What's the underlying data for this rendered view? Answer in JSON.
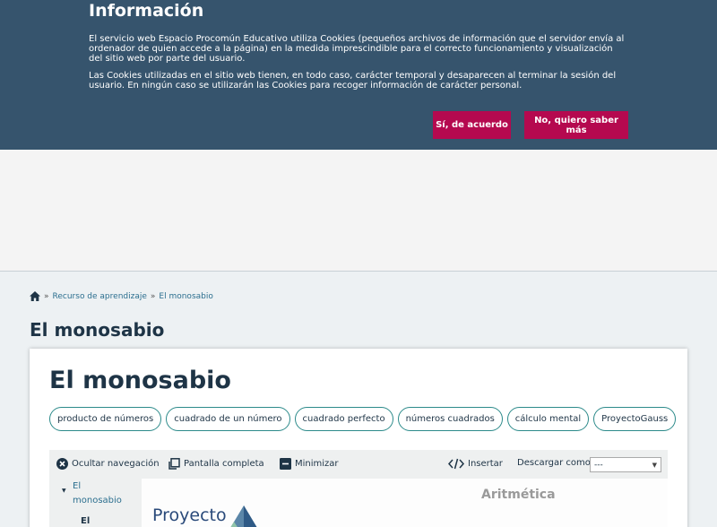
{
  "cookie": {
    "title": "Información",
    "text1": "El servicio web Espacio Procomún Educativo utiliza Cookies (pequeños archivos de información que el servidor envía al ordenador de quien accede a la página) en la medida imprescindible para el correcto funcionamiento y visualización del sitio web por parte del usuario.",
    "text2": "Las Cookies utilizadas en el sitio web tienen, en todo caso, carácter temporal y desaparecen al terminar la sesión del usuario. En ningún caso se utilizarán las Cookies para recoger información de carácter personal.",
    "accept_label": "Sí, de acuerdo",
    "more_label": "No, quiero saber más"
  },
  "breadcrumb": {
    "home_icon": "home-icon",
    "sep1": "»",
    "item1": "Recurso de aprendizaje",
    "sep2": "»",
    "item2": "El monosabio"
  },
  "page_title": "El monosabio",
  "card": {
    "title": "El monosabio",
    "tags": [
      "producto de números",
      "cuadrado de un número",
      "cuadrado perfecto",
      "números cuadrados",
      "cálculo mental",
      "ProyectoGauss"
    ]
  },
  "toolbar": {
    "hide_nav": "Ocultar navegación",
    "fullscreen": "Pantalla completa",
    "minimize": "Minimizar",
    "insert": "Insertar",
    "download_label": "Descargar como",
    "download_value": "---"
  },
  "nav": {
    "item1_line1": "El",
    "item1_line2": "monosabio",
    "item2": "El"
  },
  "viewer": {
    "title": "Aritmética",
    "logo": "Proyecto"
  },
  "colors": {
    "banner_bg": "#36546d",
    "button_bg": "#b5094f",
    "tag_border": "#2c8a8a",
    "title_color": "#1e3446",
    "link_color": "#2c6f8f"
  }
}
